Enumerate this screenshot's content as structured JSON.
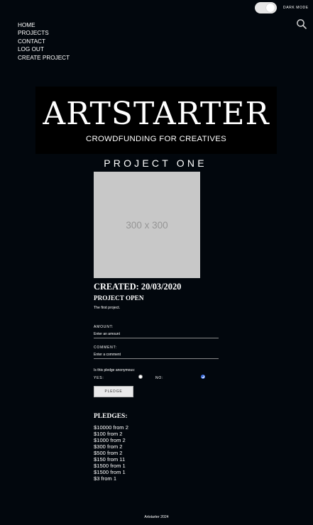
{
  "header": {
    "dark_mode_label": "DARK MODE",
    "dark_mode_on": true,
    "search_icon": "search-icon"
  },
  "nav": {
    "items": [
      "HOME",
      "PROJECTS",
      "CONTACT",
      "LOG OUT",
      "CREATE PROJECT"
    ]
  },
  "logo": {
    "title": "ARTSTARTER",
    "tagline": "CROWDFUNDING FOR CREATIVES"
  },
  "project": {
    "title": "PROJECT ONE",
    "image_placeholder": "300 x 300",
    "created": "CREATED: 20/03/2020",
    "status": "PROJECT OPEN",
    "description": "The first project."
  },
  "form": {
    "amount_label": "AMOUNT:",
    "amount_placeholder": "Enter an amount",
    "comment_label": "COMMENT:",
    "comment_placeholder": "Enter a comment",
    "anonymous_question": "Is this pledge anonymous:",
    "yes_label": "YES:",
    "no_label": "NO:",
    "anonymous_selected": "no",
    "submit_label": "PLEDGE"
  },
  "pledges": {
    "title": "PLEDGES:",
    "items": [
      "$10000 from 2",
      "$100 from 2",
      "$1000 from 2",
      "$300 from 2",
      "$500 from 2",
      "$150 from 11",
      "$1500 from 1",
      "$1500 from 1",
      "$3 from 1"
    ]
  },
  "footer": {
    "text": "Artstarter 2024"
  },
  "colors": {
    "background": "#02070d",
    "text": "#ffffff",
    "radio_accent": "#3b6de2"
  }
}
